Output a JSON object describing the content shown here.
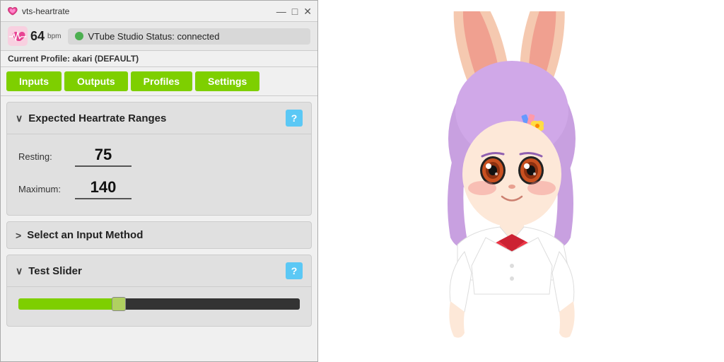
{
  "window": {
    "title": "vts-heartrate",
    "controls": [
      "—",
      "□",
      "✕"
    ]
  },
  "statusbar": {
    "bpm": "64",
    "bpm_unit": "bpm",
    "vtube_status": "VTube Studio Status: connected",
    "status_color": "#4caf50"
  },
  "profilebar": {
    "label": "Current Profile:",
    "profile_name": "akari (DEFAULT)"
  },
  "navtabs": {
    "tabs": [
      {
        "label": "Inputs",
        "id": "inputs"
      },
      {
        "label": "Outputs",
        "id": "outputs"
      },
      {
        "label": "Profiles",
        "id": "profiles"
      },
      {
        "label": "Settings",
        "id": "settings"
      }
    ]
  },
  "sections": {
    "heartrate_ranges": {
      "title": "Expected Heartrate Ranges",
      "expanded": true,
      "chevron": "∨",
      "help": "?",
      "resting_label": "Resting:",
      "resting_value": "75",
      "maximum_label": "Maximum:",
      "maximum_value": "140"
    },
    "input_method": {
      "title": "Select an Input Method",
      "expanded": false,
      "chevron": ">"
    },
    "test_slider": {
      "title": "Test Slider",
      "expanded": true,
      "chevron": "∨",
      "help": "?",
      "slider_value": 35
    }
  }
}
